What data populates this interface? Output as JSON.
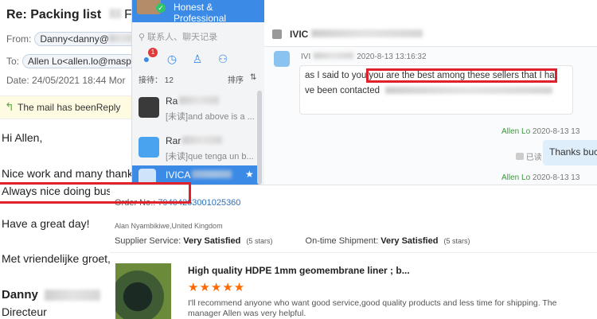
{
  "email": {
    "subject": "Re: Packing list",
    "subject_suffix": "F",
    "from_label": "From:",
    "from_value": "Danny<danny@",
    "to_label": "To:",
    "to_value": "Allen Lo<allen.lo@masp",
    "date_text": "Date: 24/05/2021 18:44 Mor",
    "reply_notice": "The mail has beenReply",
    "lines": {
      "greeting": "Hi Allen,",
      "line1": "Nice work and many thanks",
      "line2": "Always nice doing bussiness with you.",
      "line3": "Have a great day!",
      "line4": "Met vriendelijke groet,",
      "signature_name": "Danny",
      "signature_title": "Directeur"
    }
  },
  "chat": {
    "slogan": "Honest & Professional",
    "search_placeholder": "联系人、聊天记录",
    "unread_badge": "1",
    "reception_label": "接待：",
    "reception_count": "12",
    "sort_label": "排序",
    "contacts": [
      {
        "name": "Ra",
        "preview": "[未读]and above is a ..."
      },
      {
        "name": "Rar",
        "preview": "[未读]que tenga un b..."
      },
      {
        "name": "IVICA",
        "preview": ""
      }
    ],
    "conversation_name": "IVIC",
    "messages": [
      {
        "sender": "IVI",
        "time": "2020-8-13 13:16:32",
        "pre_text": "as I said to you",
        "highlight_text": "you are the best among these sellers that I ha",
        "line2": "ve been contacted"
      },
      {
        "sender": "Allen Lo",
        "time": "2020-8-13 13",
        "read_status": "已读",
        "text": "Thanks buc"
      },
      {
        "sender": "Allen Lo",
        "time": "2020-8-13 13"
      }
    ],
    "accent_color": "#3b8ae6"
  },
  "review": {
    "order_label": "Order No.:",
    "order_number": "79404263001025360",
    "buyer": "Alan Nyambikiwe,United Kingdom",
    "supplier_service_label": "Supplier Service:",
    "supplier_service_value": "Very Satisfied",
    "supplier_service_stars": "(5 stars)",
    "shipment_label": "On-time Shipment:",
    "shipment_value": "Very Satisfied",
    "shipment_stars": "(5 stars)",
    "product_title": "High quality HDPE 1mm geomembrane liner ; b...",
    "rating": 5,
    "stars_text": "★★★★★",
    "review_text": "I'll recommend anyone who want good service,good quality  products and less time for shipping. The manager Allen was very helpful.",
    "star_color": "#ff6a00",
    "link_color": "#2d6fb7"
  },
  "annotation_color": "#e0202a"
}
